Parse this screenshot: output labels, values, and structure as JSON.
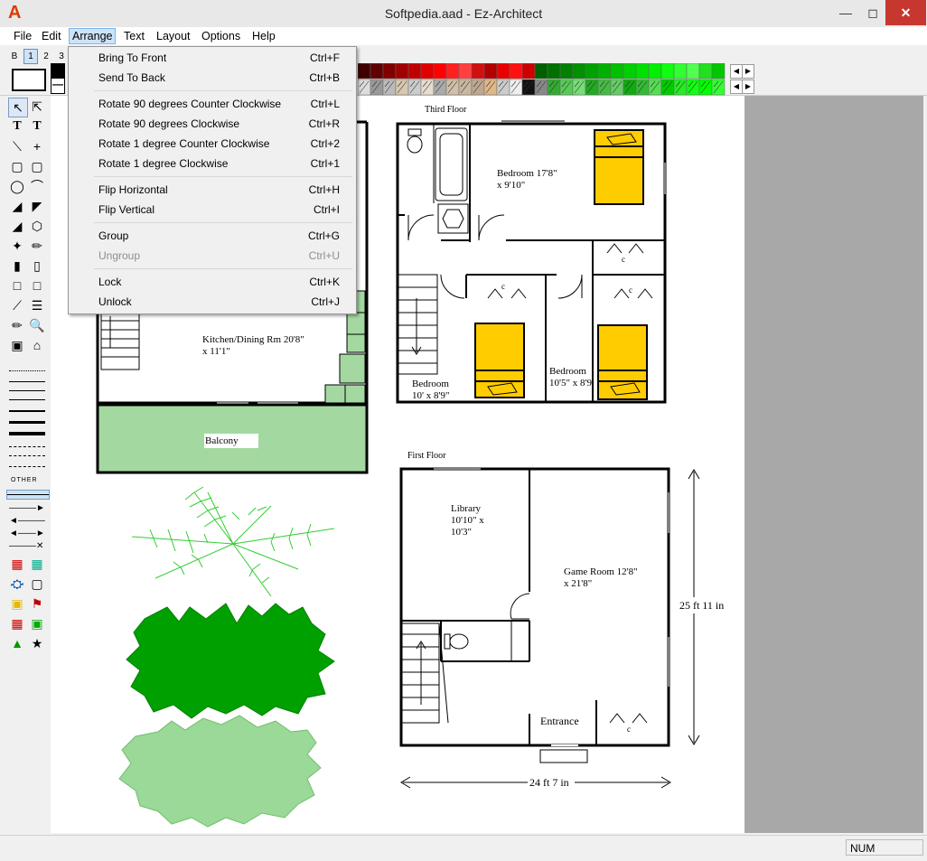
{
  "window": {
    "title": "Softpedia.aad - Ez-Architect",
    "logo": "A",
    "min_icon": "minimize-icon",
    "max_icon": "maximize-icon",
    "close_icon": "close-icon"
  },
  "menubar": {
    "items": [
      "File",
      "Edit",
      "Arrange",
      "Text",
      "Layout",
      "Options",
      "Help"
    ],
    "active": "Arrange"
  },
  "toolbar": {
    "layers": [
      "B",
      "1",
      "2",
      "3"
    ],
    "selected_layer": "1"
  },
  "arrange_menu": {
    "items": [
      {
        "label": "Bring To Front",
        "shortcut": "Ctrl+F",
        "enabled": true
      },
      {
        "label": "Send To Back",
        "shortcut": "Ctrl+B",
        "enabled": true
      },
      {
        "label": "Rotate 90 degrees Counter Clockwise",
        "shortcut": "Ctrl+L",
        "enabled": true
      },
      {
        "label": "Rotate 90 degrees Clockwise",
        "shortcut": "Ctrl+R",
        "enabled": true
      },
      {
        "label": "Rotate 1 degree Counter Clockwise",
        "shortcut": "Ctrl+2",
        "enabled": true
      },
      {
        "label": "Rotate 1 degree Clockwise",
        "shortcut": "Ctrl+1",
        "enabled": true
      },
      {
        "label": "Flip Horizontal",
        "shortcut": "Ctrl+H",
        "enabled": true
      },
      {
        "label": "Flip Vertical",
        "shortcut": "Ctrl+I",
        "enabled": true
      },
      {
        "label": "Group",
        "shortcut": "Ctrl+G",
        "enabled": true
      },
      {
        "label": "Ungroup",
        "shortcut": "Ctrl+U",
        "enabled": false
      },
      {
        "label": "Lock",
        "shortcut": "Ctrl+K",
        "enabled": true
      },
      {
        "label": "Unlock",
        "shortcut": "Ctrl+J",
        "enabled": true
      }
    ]
  },
  "tools": {
    "other_label": "OTHER"
  },
  "drawing": {
    "third_floor": "Third Floor",
    "first_floor": "First Floor",
    "bedroom1": [
      "Bedroom 17'8\"",
      "x 9'10\""
    ],
    "bedroom2": [
      "Bedroom",
      "10' x 8'9\""
    ],
    "bedroom3": [
      "Bedroom",
      "10'5\" x 8'9"
    ],
    "kitchen": [
      "Kitchen/Dining Rm 20'8\"",
      "x 11'1\""
    ],
    "balcony": "Balcony",
    "library": [
      "Library",
      "10'10\" x",
      "10'3\""
    ],
    "game_room": [
      "Game Room 12'8\"",
      "x 21'8\""
    ],
    "entrance": "Entrance",
    "closet": "c",
    "dim_height": "25 ft 11 in",
    "dim_width": "24 ft 7 in"
  },
  "status": {
    "num": "NUM"
  },
  "colors": {
    "accent": "#cde3f7",
    "bed": "#ffcc00",
    "balcony": "#a3d9a0",
    "plant_dark": "#00a000",
    "plant_light": "#9ad997"
  }
}
